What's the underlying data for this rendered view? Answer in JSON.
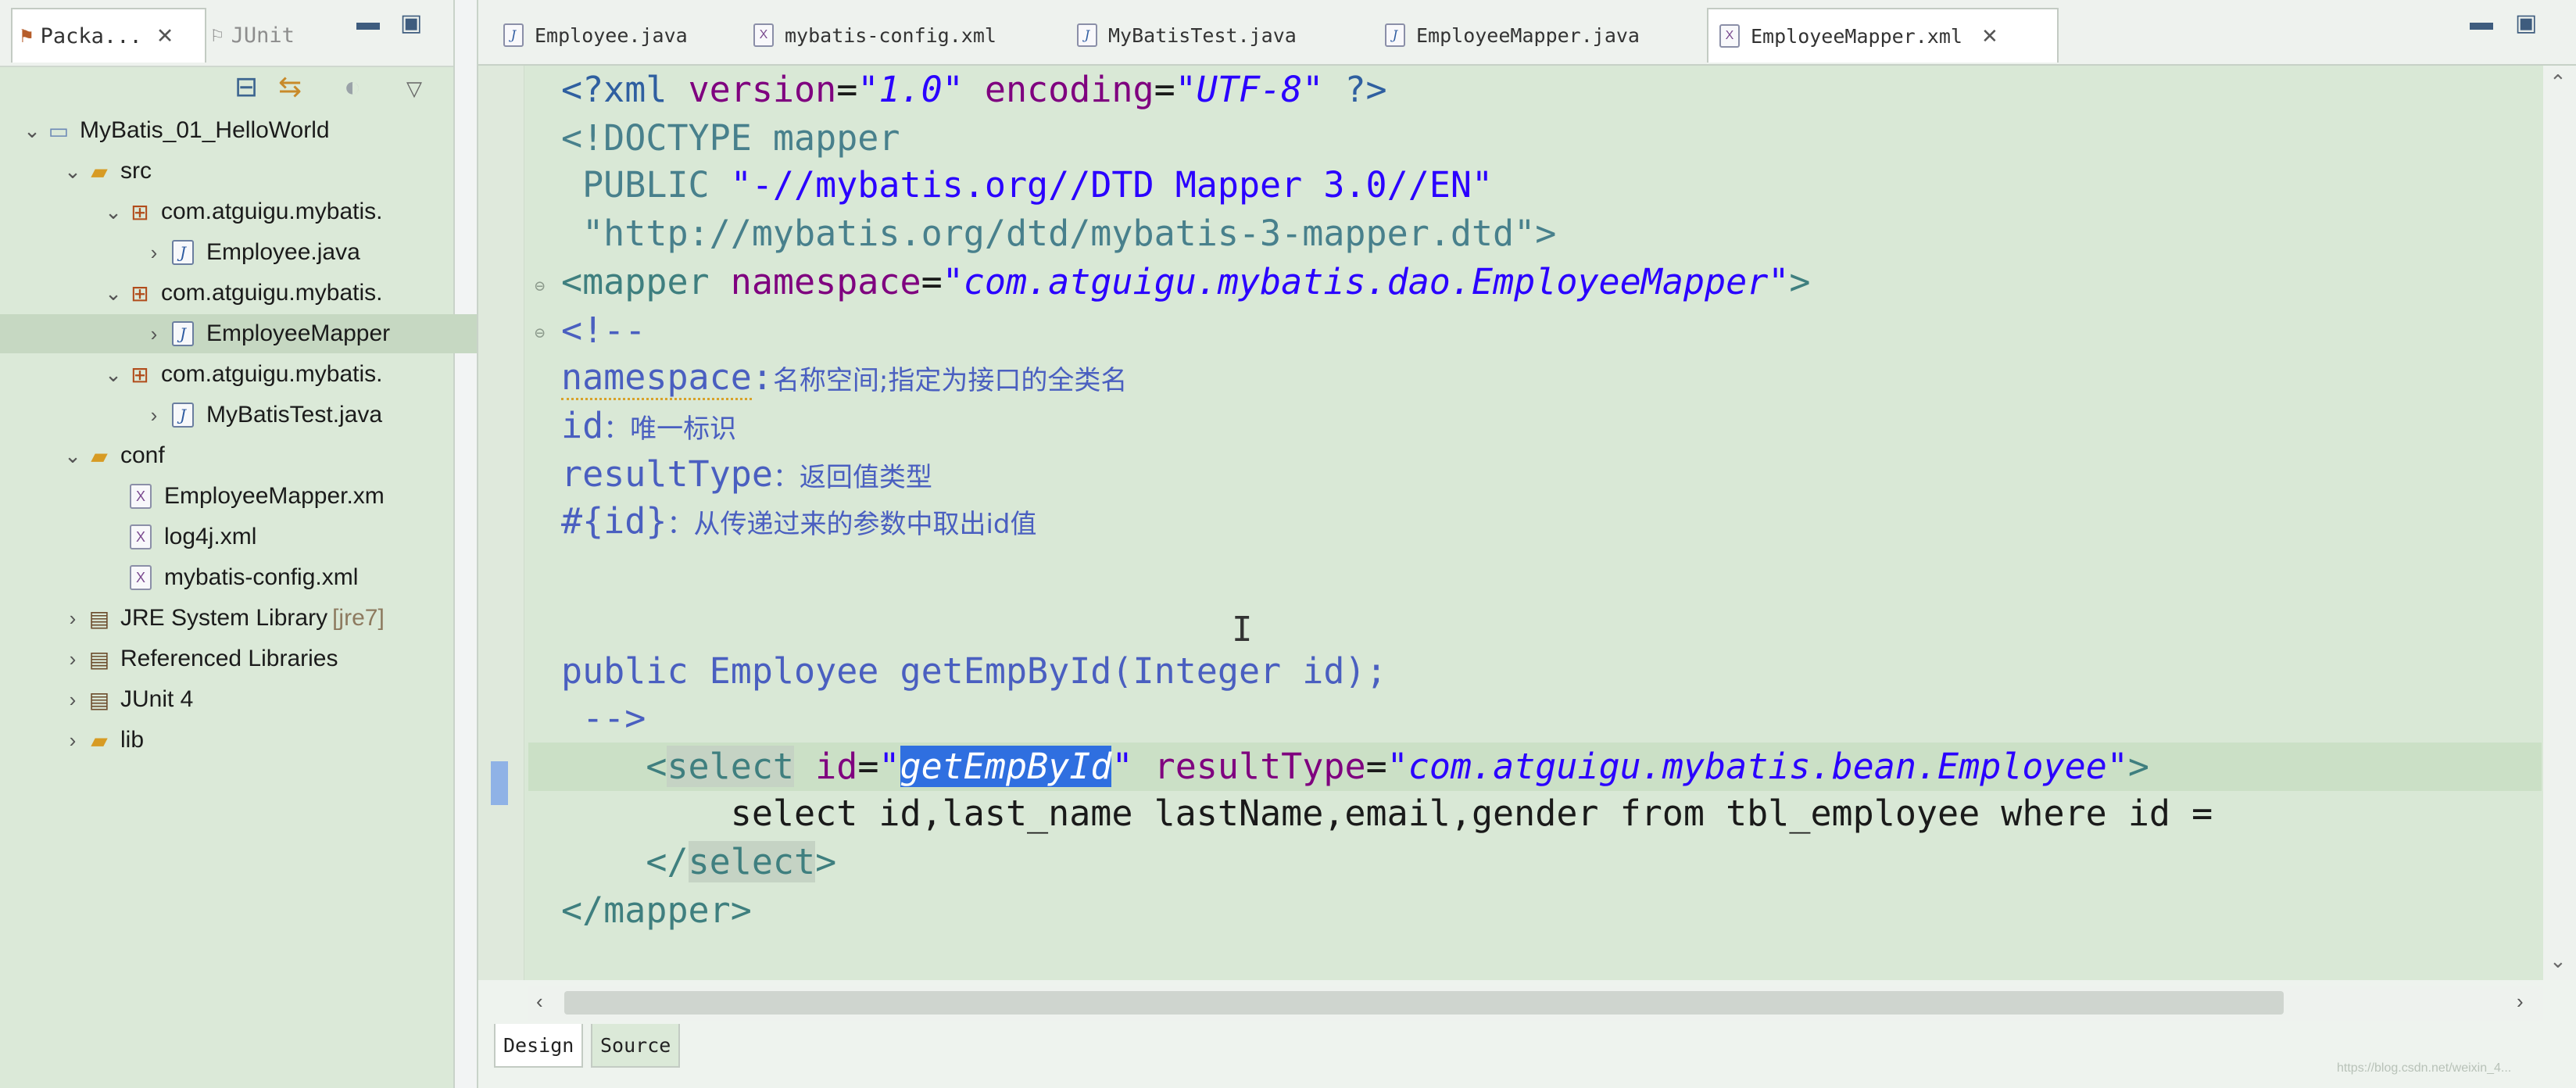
{
  "left_pane": {
    "tabs": [
      {
        "label": "Packa...",
        "close": "✕"
      },
      {
        "label": "JUnit"
      }
    ],
    "tree": [
      {
        "label": "MyBatis_01_HelloWorld",
        "icon": "project-icon",
        "twisty": "expanded"
      },
      {
        "label": "src",
        "icon": "source-folder-icon",
        "twisty": "expanded"
      },
      {
        "label": "com.atguigu.mybatis.",
        "icon": "package-icon",
        "twisty": "expanded"
      },
      {
        "label": "Employee.java",
        "icon": "java-file-icon",
        "twisty": "collapsed"
      },
      {
        "label": "com.atguigu.mybatis.",
        "icon": "package-icon",
        "twisty": "expanded"
      },
      {
        "label": "EmployeeMapper",
        "icon": "java-file-icon",
        "twisty": "collapsed",
        "selected": true
      },
      {
        "label": "com.atguigu.mybatis.",
        "icon": "package-icon",
        "twisty": "expanded"
      },
      {
        "label": "MyBatisTest.java",
        "icon": "java-file-icon",
        "twisty": "collapsed"
      },
      {
        "label": "conf",
        "icon": "folder-icon",
        "twisty": "expanded"
      },
      {
        "label": "EmployeeMapper.xm",
        "icon": "xml-file-icon",
        "twisty": "none"
      },
      {
        "label": "log4j.xml",
        "icon": "xml-file-icon",
        "twisty": "none"
      },
      {
        "label": "mybatis-config.xml",
        "icon": "xml-file-icon",
        "twisty": "none"
      },
      {
        "label": "JRE System Library",
        "sub": "[jre7]",
        "icon": "library-icon",
        "twisty": "collapsed"
      },
      {
        "label": "Referenced Libraries",
        "icon": "library-icon",
        "twisty": "collapsed"
      },
      {
        "label": "JUnit 4",
        "icon": "library-icon",
        "twisty": "collapsed"
      },
      {
        "label": "lib",
        "icon": "folder-icon",
        "twisty": "collapsed"
      }
    ]
  },
  "editor": {
    "tabs": [
      {
        "label": "Employee.java",
        "icon": "java-file-icon"
      },
      {
        "label": "mybatis-config.xml",
        "icon": "xml-file-icon"
      },
      {
        "label": "MyBatisTest.java",
        "icon": "java-file-icon"
      },
      {
        "label": "EmployeeMapper.java",
        "icon": "java-file-icon"
      },
      {
        "label": "EmployeeMapper.xml",
        "icon": "xml-file-icon",
        "active": true
      }
    ],
    "code": {
      "l1": {
        "a": "<?xml ",
        "b": "version",
        "c": "=",
        "d": "\"1.0\"",
        "e": " ",
        "f": "encoding",
        "g": "=",
        "h": "\"UTF-8\"",
        "i": " ?>"
      },
      "l2": "<!DOCTYPE mapper",
      "l3a": " PUBLIC ",
      "l3b": "\"-//mybatis.org//DTD Mapper 3.0//EN\"",
      "l4": " \"http://mybatis.org/dtd/mybatis-3-mapper.dtd\">",
      "l5": {
        "open": "<mapper ",
        "attr": "namespace",
        "eq": "=",
        "val": "\"com.atguigu.mybatis.dao.EmployeeMapper\"",
        "close": ">"
      },
      "l6": "<!--",
      "l7": {
        "key": "namespace",
        "colon": ":",
        "text": "名称空间;指定为接口的全类名"
      },
      "l8": {
        "key": "id",
        "text": "：唯一标识"
      },
      "l9": {
        "key": "resultType",
        "text": "：返回值类型"
      },
      "l10": {
        "key": "#{id}",
        "text": "：从传递过来的参数中取出id值"
      },
      "l11": "public Employee getEmpById(Integer id);",
      "l12": " -->",
      "l13": {
        "indent": "    ",
        "lt": "<",
        "tag": "select",
        "sp": " ",
        "attr1": "id",
        "eq1": "=",
        "q1": "\"",
        "val1": "getEmpById",
        "q2": "\"",
        "sp2": " ",
        "attr2": "resultType",
        "eq2": "=",
        "val2": "\"com.atguigu.mybatis.bean.Employee\"",
        "gt": ">"
      },
      "l14": "        select id,last_name lastName,email,gender from tbl_employee where id =",
      "l15": {
        "indent": "    ",
        "lt": "</",
        "tag": "select",
        "gt": ">"
      },
      "l16": "</mapper>"
    },
    "bottom_tabs": {
      "design": "Design",
      "source": "Source"
    }
  },
  "watermark": "https://blog.csdn.net/weixin_4..."
}
